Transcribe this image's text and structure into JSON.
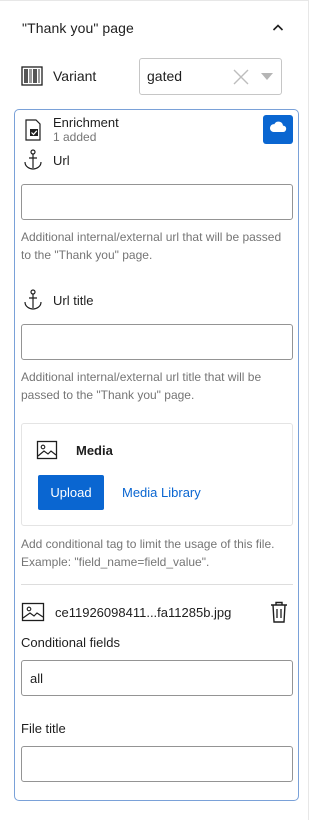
{
  "header": {
    "title": "\"Thank you\" page"
  },
  "variant": {
    "label": "Variant",
    "value": "gated"
  },
  "enrichment": {
    "title": "Enrichment",
    "subtitle": "1 added",
    "url": {
      "label": "Url",
      "value": "",
      "help": "Additional internal/external url that will be passed to the \"Thank you\" page."
    },
    "url_title": {
      "label": "Url title",
      "value": "",
      "help": "Additional internal/external url title that will be passed to the \"Thank you\" page."
    },
    "media": {
      "title": "Media",
      "upload_label": "Upload",
      "library_label": "Media Library",
      "help": "Add conditional tag to limit the usage of this file. Example: \"field_name=field_value\"."
    },
    "file": {
      "name": "ce11926098411...fa11285b.jpg"
    },
    "conditional_fields": {
      "label": "Conditional fields",
      "value": "all"
    },
    "file_title": {
      "label": "File title",
      "value": ""
    }
  },
  "colors": {
    "accent": "#0a66d1",
    "card_border": "#7aa1d8"
  }
}
